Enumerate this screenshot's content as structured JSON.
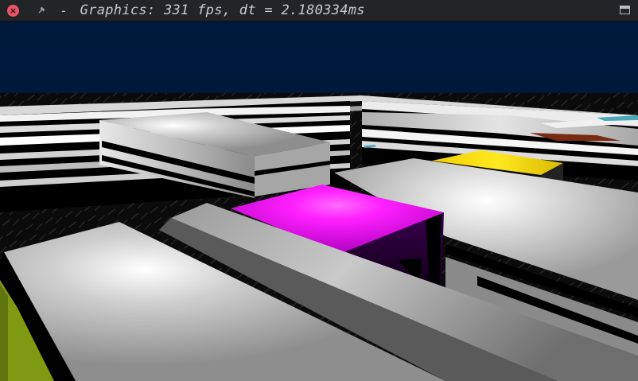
{
  "window": {
    "separator": "-",
    "title": "Graphics: 331 fps, dt = 2.180334ms",
    "icons": {
      "close": "close-icon",
      "sticky": "pin-icon",
      "maximize": "maximize-icon"
    }
  },
  "scene": {
    "sky_color": "#001a3d",
    "floor_color": "#0a0a0a",
    "block_color": "#c8c8c8",
    "highlight_magenta": "#ff20ff",
    "highlight_yellow": "#ffe20a",
    "accent_red": "#7a2a12",
    "accent_olive": "#7d9a12",
    "accent_cyan": "#4aa8b8"
  }
}
